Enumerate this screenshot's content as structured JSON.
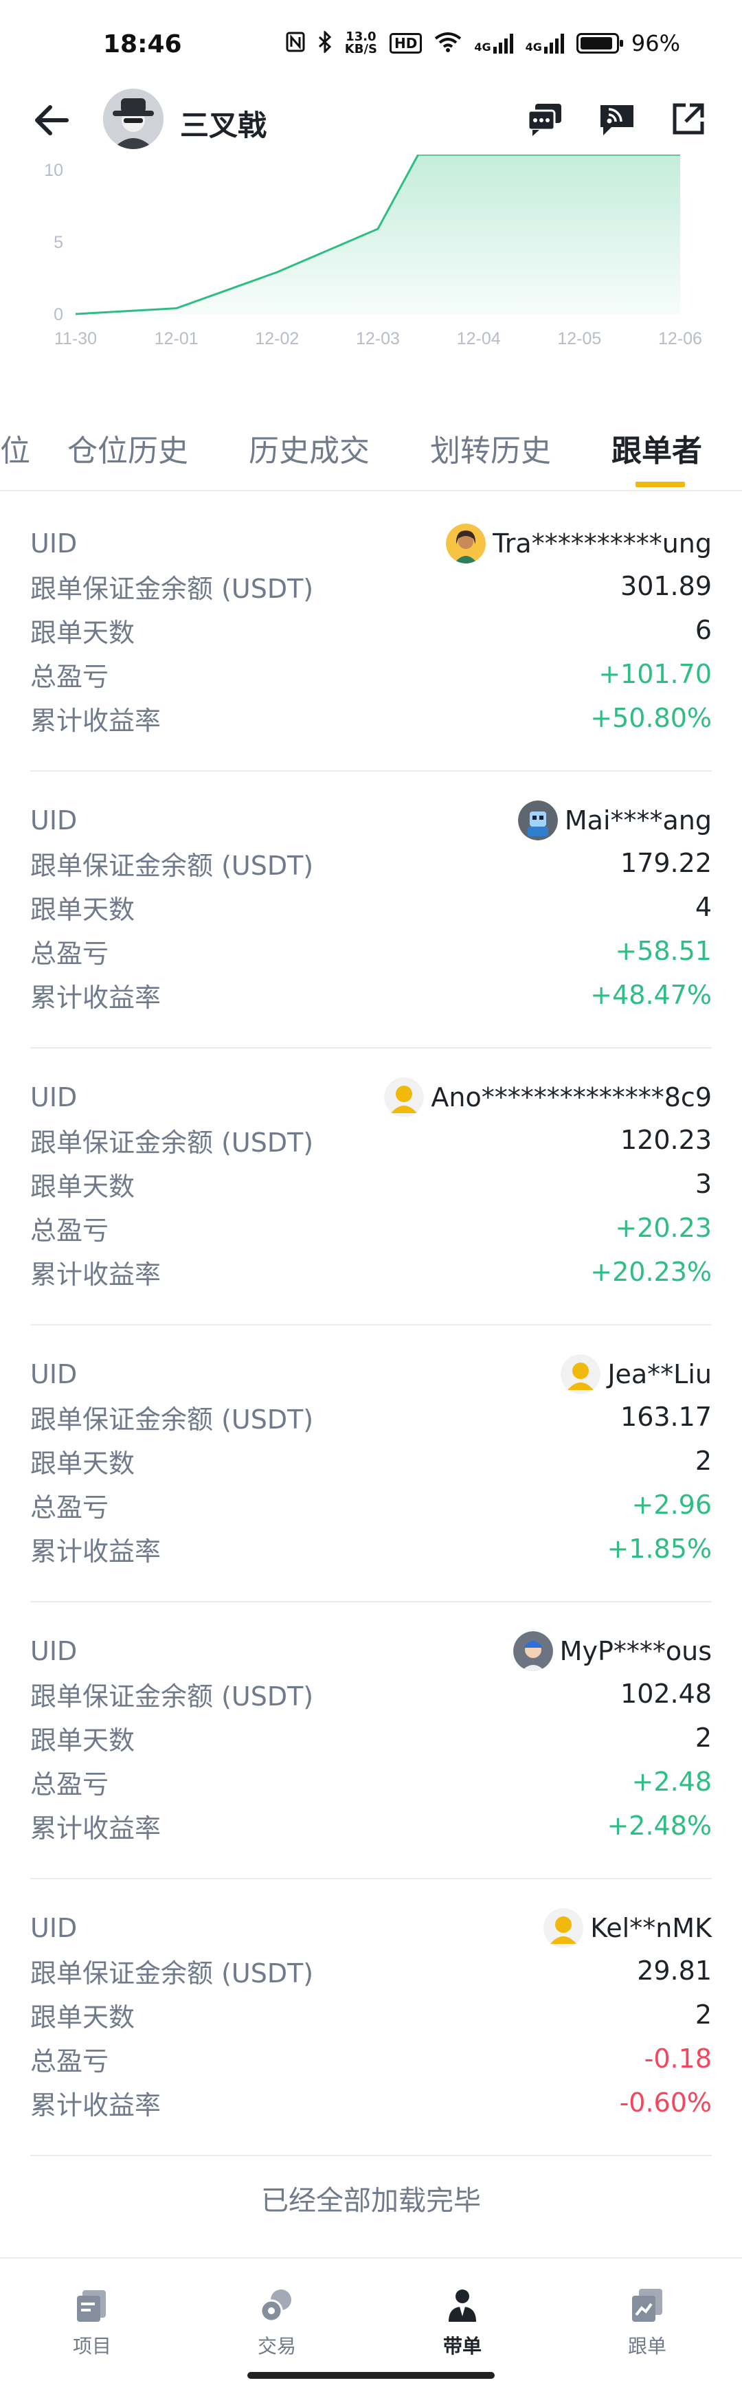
{
  "status_bar": {
    "time": "18:46",
    "speed_top": "13.0",
    "speed_bottom": "KB/S",
    "hd": "HD",
    "net1": "4G",
    "net2": "4G",
    "battery": "96%"
  },
  "header": {
    "name": "三叉戟"
  },
  "chart_data": {
    "type": "area",
    "x": [
      "11-30",
      "12-01",
      "12-02",
      "12-03",
      "12-04",
      "12-05",
      "12-06"
    ],
    "y_ticks": [
      "10",
      "5",
      "0"
    ],
    "ylim": [
      0,
      10
    ],
    "series": [
      {
        "values": [
          0,
          0.4,
          2.9,
          5.9,
          10,
          10,
          10
        ]
      }
    ],
    "color": "#2ebd85"
  },
  "tabs": [
    {
      "label": "位"
    },
    {
      "label": "仓位历史"
    },
    {
      "label": "历史成交"
    },
    {
      "label": "划转历史"
    },
    {
      "label": "跟单者"
    }
  ],
  "labels": {
    "uid": "UID",
    "margin": "跟单保证金余额 (USDT)",
    "days": "跟单天数",
    "pnl": "总盈亏",
    "roi": "累计收益率"
  },
  "followers": [
    {
      "name": "Tra**********ung",
      "margin": "301.89",
      "days": "6",
      "pnl": "+101.70",
      "roi": "+50.80%",
      "pnl_sign": "pos"
    },
    {
      "name": "Mai****ang",
      "margin": "179.22",
      "days": "4",
      "pnl": "+58.51",
      "roi": "+48.47%",
      "pnl_sign": "pos"
    },
    {
      "name": "Ano**************8c9",
      "margin": "120.23",
      "days": "3",
      "pnl": "+20.23",
      "roi": "+20.23%",
      "pnl_sign": "pos"
    },
    {
      "name": "Jea**Liu",
      "margin": "163.17",
      "days": "2",
      "pnl": "+2.96",
      "roi": "+1.85%",
      "pnl_sign": "pos"
    },
    {
      "name": "MyP****ous",
      "margin": "102.48",
      "days": "2",
      "pnl": "+2.48",
      "roi": "+2.48%",
      "pnl_sign": "pos"
    },
    {
      "name": "Kel**nMK",
      "margin": "29.81",
      "days": "2",
      "pnl": "-0.18",
      "roi": "-0.60%",
      "pnl_sign": "neg"
    }
  ],
  "footer_note": "已经全部加载完毕",
  "bottom_nav": [
    {
      "label": "项目",
      "icon": "project-icon"
    },
    {
      "label": "交易",
      "icon": "trade-icon"
    },
    {
      "label": "带单",
      "icon": "lead-trade-icon",
      "active": true
    },
    {
      "label": "跟单",
      "icon": "copy-trade-icon"
    }
  ]
}
